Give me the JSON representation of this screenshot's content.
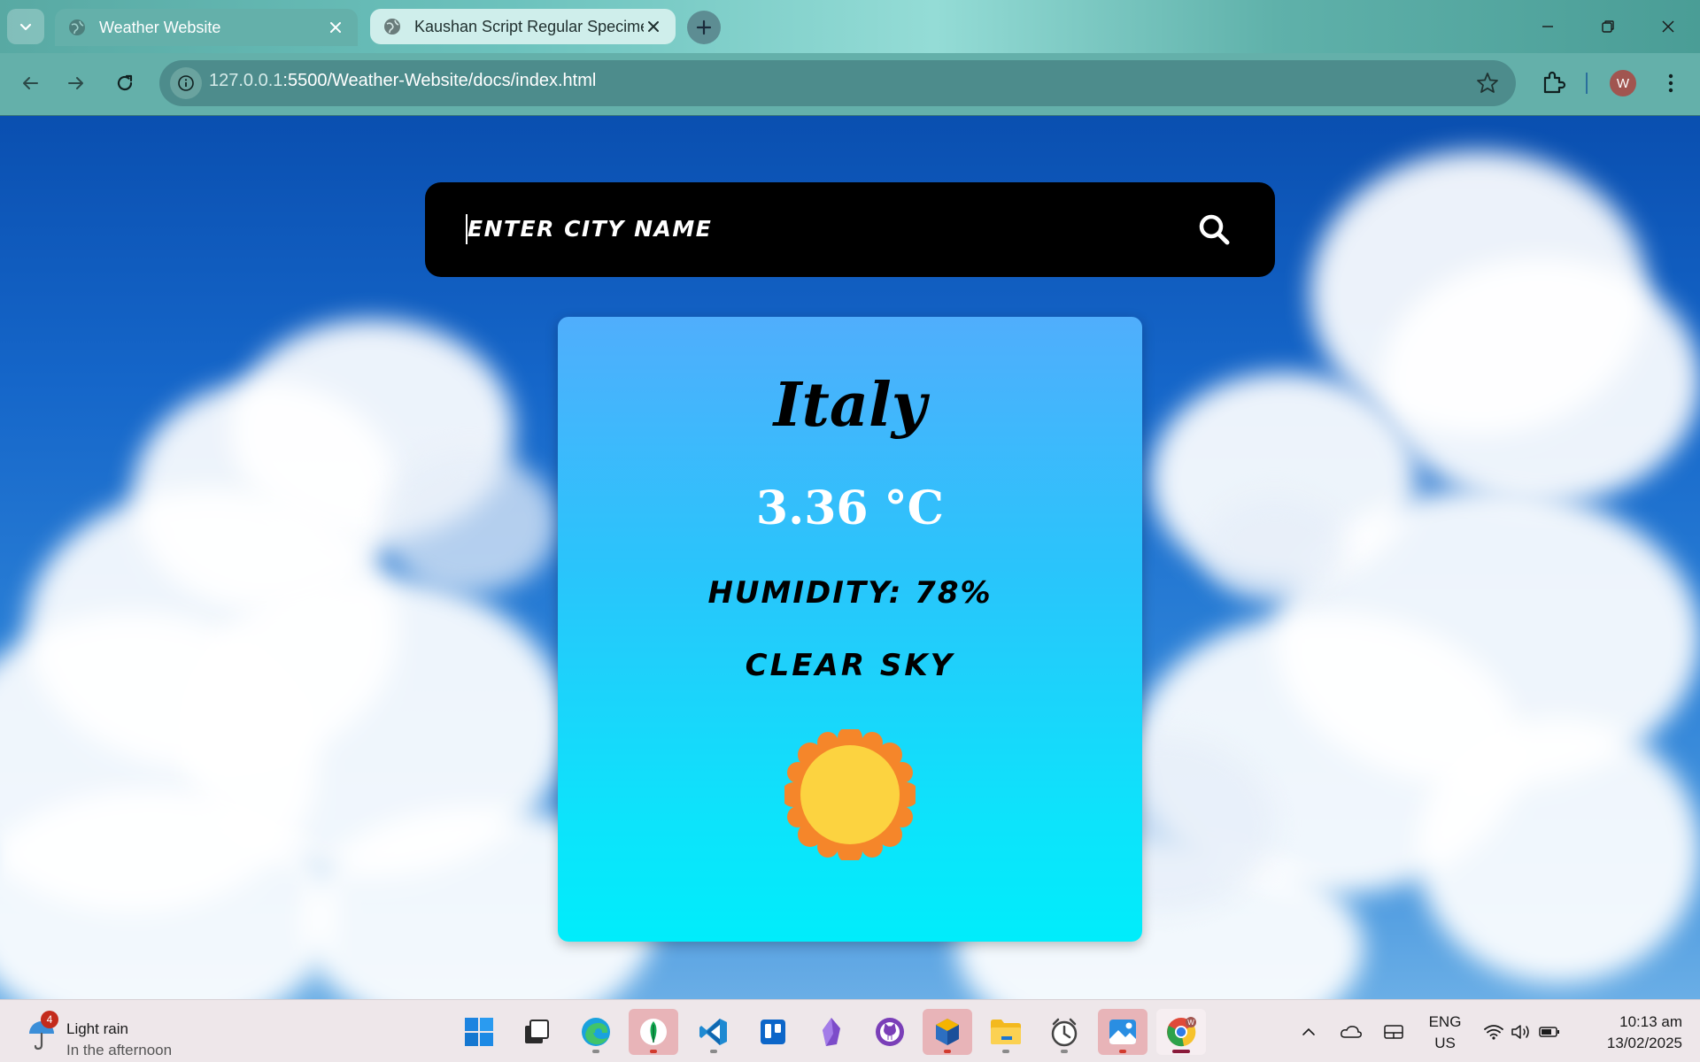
{
  "browser": {
    "tabs": [
      {
        "title": "Weather Website",
        "active": true
      },
      {
        "title": "Kaushan Script Regular Specimen",
        "active": false
      }
    ],
    "address": {
      "host": "127.0.0.1",
      "path": ":5500/Weather-Website/docs/index.html"
    },
    "profile_initial": "W"
  },
  "page": {
    "search": {
      "placeholder": "ENTER CITY NAME",
      "value": ""
    },
    "weather": {
      "city": "Italy",
      "temperature": "3.36 °C",
      "humidity": "HUMIDITY: 78%",
      "condition": "CLEAR SKY",
      "icon": "sun-icon"
    }
  },
  "taskbar": {
    "weather_widget": {
      "badge": "4",
      "title": "Light rain",
      "subtitle": "In the afternoon"
    },
    "apps": [
      "windows-start",
      "task-view",
      "edge",
      "mongodb-compass",
      "vscode",
      "trello",
      "obsidian",
      "github-desktop",
      "virtualbox",
      "file-explorer",
      "clock",
      "photos",
      "chrome"
    ],
    "language": {
      "line1": "ENG",
      "line2": "US"
    },
    "clock": {
      "time": "10:13 am",
      "date": "13/02/2025"
    }
  },
  "colors": {
    "card_top": "#50aefc",
    "card_bottom": "#00edfb",
    "search_bg": "#000000",
    "sun_outer": "#f5862a",
    "sun_inner": "#fcd340"
  }
}
